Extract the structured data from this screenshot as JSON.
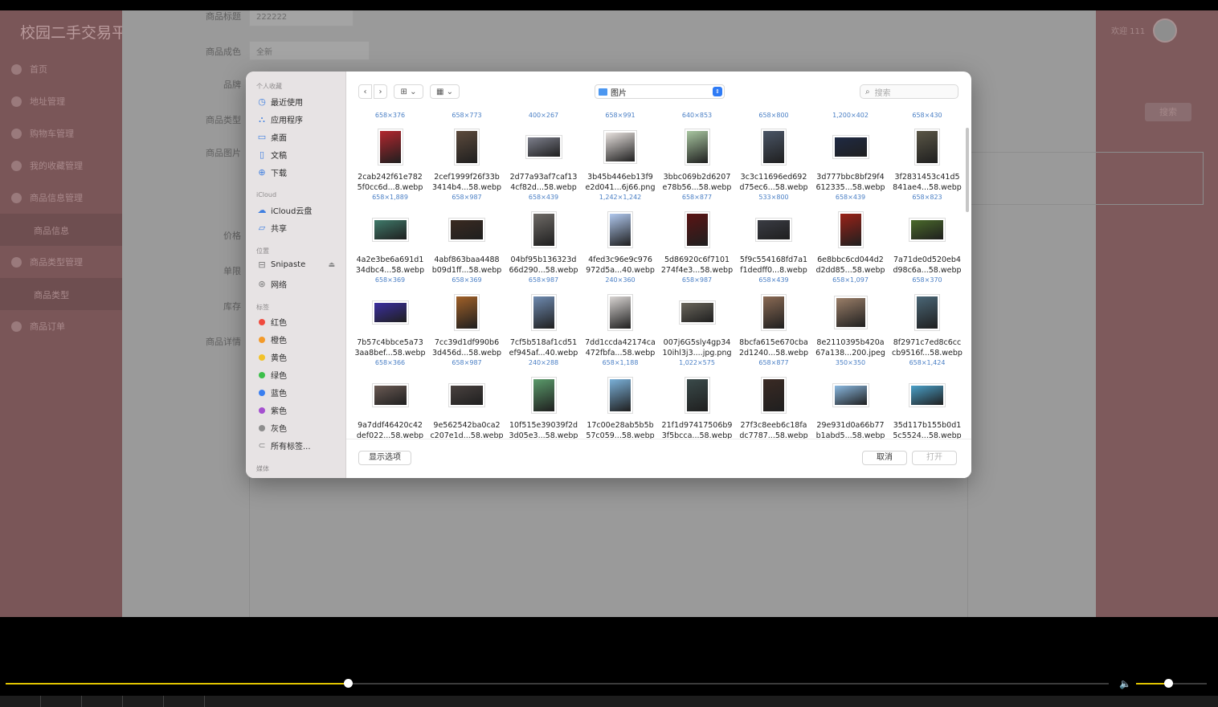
{
  "app": {
    "logo": "校园二手交易平",
    "welcome": "欢迎 111",
    "search_button": "搜索",
    "sidebar": [
      {
        "label": "首页",
        "icon": "home-icon"
      },
      {
        "label": "地址管理",
        "icon": "address-icon"
      },
      {
        "label": "购物车管理",
        "icon": "cart-icon"
      },
      {
        "label": "我的收藏管理",
        "icon": "favorite-icon"
      },
      {
        "label": "商品信息管理",
        "icon": "goods-icon"
      },
      {
        "label": "商品信息",
        "icon": ""
      },
      {
        "label": "商品类型管理",
        "icon": "type-icon"
      },
      {
        "label": "商品类型",
        "icon": ""
      },
      {
        "label": "商品订单",
        "icon": "order-icon"
      }
    ],
    "form": {
      "title_label": "商品标题",
      "title_value": "222222",
      "condition_label": "商品成色",
      "condition_value": "全新",
      "brand_label": "品牌",
      "type_label": "商品类型",
      "image_label": "商品图片",
      "price_label": "价格",
      "limit_label": "单限",
      "stock_label": "库存",
      "detail_label": "商品详情"
    }
  },
  "dialog": {
    "sidebar": {
      "favorites_title": "个人收藏",
      "favorites": [
        {
          "label": "最近使用",
          "icon": "clock-icon"
        },
        {
          "label": "应用程序",
          "icon": "apps-icon"
        },
        {
          "label": "桌面",
          "icon": "desktop-icon"
        },
        {
          "label": "文稿",
          "icon": "document-icon"
        },
        {
          "label": "下载",
          "icon": "download-icon"
        }
      ],
      "icloud_title": "iCloud",
      "icloud": [
        {
          "label": "iCloud云盘",
          "icon": "cloud-icon"
        },
        {
          "label": "共享",
          "icon": "shared-folder-icon"
        }
      ],
      "locations_title": "位置",
      "locations": [
        {
          "label": "Snipaste",
          "icon": "drive-icon"
        },
        {
          "label": "网络",
          "icon": "network-icon"
        }
      ],
      "tags_title": "标签",
      "tags": [
        {
          "label": "红色",
          "color": "#f04a3e"
        },
        {
          "label": "橙色",
          "color": "#f39a2a"
        },
        {
          "label": "黄色",
          "color": "#f2c22a"
        },
        {
          "label": "绿色",
          "color": "#3cbf4a"
        },
        {
          "label": "蓝色",
          "color": "#3a7ff0"
        },
        {
          "label": "紫色",
          "color": "#a550d0"
        },
        {
          "label": "灰色",
          "color": "#8e8e8e"
        }
      ],
      "all_tags": "所有标签...",
      "media_title": "媒体"
    },
    "location": "图片",
    "search_placeholder": "搜索",
    "prev_row_dims": [
      "658×376",
      "658×773",
      "400×267",
      "658×991",
      "640×853",
      "658×800",
      "1,200×402",
      "658×430"
    ],
    "files": [
      {
        "l1": "2cab242f61e782",
        "l2": "5f0cc6d...8.webp",
        "dim": "658×1,889",
        "color": "#b3262e",
        "shape": "tall"
      },
      {
        "l1": "2cef1999f26f33b",
        "l2": "3414b4...58.webp",
        "dim": "658×987",
        "color": "#5c4a3c",
        "shape": "tall"
      },
      {
        "l1": "2d77a93af7caf13",
        "l2": "4cf82d...58.webp",
        "dim": "658×439",
        "color": "#7d7f8c",
        "shape": "wide"
      },
      {
        "l1": "3b45b446eb13f9",
        "l2": "e2d041...6j66.png",
        "dim": "1,242×1,242",
        "color": "#e8e2df",
        "shape": "square"
      },
      {
        "l1": "3bbc069b2d6207",
        "l2": "e78b56...58.webp",
        "dim": "658×877",
        "color": "#a8c6a0",
        "shape": "tall"
      },
      {
        "l1": "3c3c11696ed692",
        "l2": "d75ec6...58.webp",
        "dim": "533×800",
        "color": "#4a5566",
        "shape": "tall"
      },
      {
        "l1": "3d777bbc8bf29f4",
        "l2": "612335...58.webp",
        "dim": "658×439",
        "color": "#1f2a44",
        "shape": "wide"
      },
      {
        "l1": "3f2831453c41d5",
        "l2": "841ae4...58.webp",
        "dim": "658×823",
        "color": "#5a5646",
        "shape": "tall"
      },
      {
        "l1": "4a2e3be6a691d1",
        "l2": "34dbc4...58.webp",
        "dim": "658×369",
        "color": "#3f7a6a",
        "shape": "wide"
      },
      {
        "l1": "4abf863baa4488",
        "l2": "b09d1ff...58.webp",
        "dim": "658×369",
        "color": "#3a2a20",
        "shape": "wide"
      },
      {
        "l1": "04bf95b136323d",
        "l2": "66d290...58.webp",
        "dim": "658×987",
        "color": "#6e6a66",
        "shape": "tall"
      },
      {
        "l1": "4fed3c96e9c976",
        "l2": "972d5a...40.webp",
        "dim": "240×360",
        "color": "#b0c8ee",
        "shape": "tall"
      },
      {
        "l1": "5d86920c6f7101",
        "l2": "274f4e3...58.webp",
        "dim": "658×987",
        "color": "#5a1414",
        "shape": "tall"
      },
      {
        "l1": "5f9c554168fd7a1",
        "l2": "f1dedff0...8.webp",
        "dim": "658×439",
        "color": "#3a3c44",
        "shape": "wide"
      },
      {
        "l1": "6e8bbc6cd044d2",
        "l2": "d2dd85...58.webp",
        "dim": "658×1,097",
        "color": "#9a2218",
        "shape": "tall"
      },
      {
        "l1": "7a71de0d520eb4",
        "l2": "d98c6a...58.webp",
        "dim": "658×370",
        "color": "#4a6a2a",
        "shape": "wide"
      },
      {
        "l1": "7b57c4bbce5a73",
        "l2": "3aa8bef...58.webp",
        "dim": "658×366",
        "color": "#3b2fa0",
        "shape": "wide"
      },
      {
        "l1": "7cc39d1df990b6",
        "l2": "3d456d...58.webp",
        "dim": "658×987",
        "color": "#a06028",
        "shape": "tall"
      },
      {
        "l1": "7cf5b518af1cd51",
        "l2": "ef945af...40.webp",
        "dim": "240×288",
        "color": "#6e8ab0",
        "shape": "tall"
      },
      {
        "l1": "7dd1ccda42174ca",
        "l2": "472fbfa...58.webp",
        "dim": "658×1,188",
        "color": "#d8d4d2",
        "shape": "tall"
      },
      {
        "l1": "007j6G5sly4gp34",
        "l2": "10ihl3j3....jpg.png",
        "dim": "1,022×575",
        "color": "#6a665c",
        "shape": "wide"
      },
      {
        "l1": "8bcfa615e670cba",
        "l2": "2d1240...58.webp",
        "dim": "658×877",
        "color": "#8a6a54",
        "shape": "tall"
      },
      {
        "l1": "8e2110395b420a",
        "l2": "67a138...200.jpeg",
        "dim": "350×350",
        "color": "#9a7e68",
        "shape": "square"
      },
      {
        "l1": "8f2971c7ed8c6cc",
        "l2": "cb9516f...58.webp",
        "dim": "658×1,424",
        "color": "#4a6676",
        "shape": "tall"
      },
      {
        "l1": "9a7ddf46420c42",
        "l2": "def022...58.webp",
        "dim": "",
        "color": "#6a5a54",
        "shape": "wide"
      },
      {
        "l1": "9e562542ba0ca2",
        "l2": "c207e1d...58.webp",
        "dim": "",
        "color": "#4a4240",
        "shape": "wide"
      },
      {
        "l1": "10f515e39039f2d",
        "l2": "3d05e3...58.webp",
        "dim": "",
        "color": "#5a9a6a",
        "shape": "tall"
      },
      {
        "l1": "17c00e28ab5b5b",
        "l2": "57c059...58.webp",
        "dim": "",
        "color": "#7ab0d8",
        "shape": "tall"
      },
      {
        "l1": "21f1d97417506b9",
        "l2": "3f5bcca...58.webp",
        "dim": "",
        "color": "#3a4a4a",
        "shape": "tall"
      },
      {
        "l1": "27f3c8eeb6c18fa",
        "l2": "dc7787...58.webp",
        "dim": "",
        "color": "#3a2a24",
        "shape": "tall"
      },
      {
        "l1": "29e931d0a66b77",
        "l2": "b1abd5...58.webp",
        "dim": "",
        "color": "#8ab8e0",
        "shape": "wide"
      },
      {
        "l1": "35d117b155b0d1",
        "l2": "5c5524...58.webp",
        "dim": "",
        "color": "#4aa0c8",
        "shape": "wide"
      }
    ],
    "options_button": "显示选项",
    "cancel_button": "取消",
    "open_button": "打开"
  },
  "player": {
    "progress": 0.31,
    "volume": 0.45
  }
}
